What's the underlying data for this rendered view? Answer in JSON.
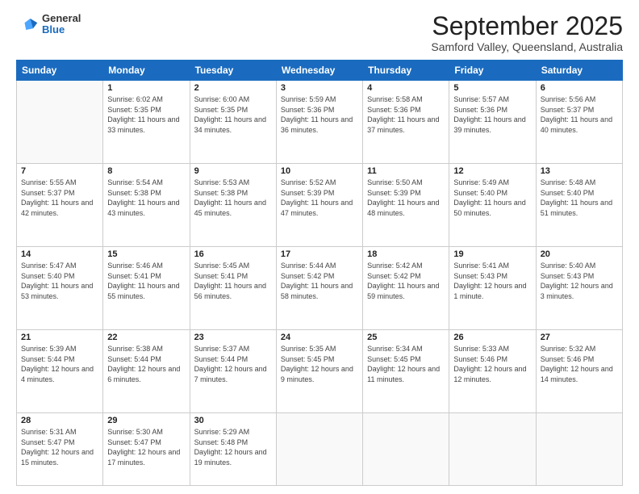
{
  "header": {
    "logo": {
      "line1": "General",
      "line2": "Blue"
    },
    "month": "September 2025",
    "location": "Samford Valley, Queensland, Australia"
  },
  "weekdays": [
    "Sunday",
    "Monday",
    "Tuesday",
    "Wednesday",
    "Thursday",
    "Friday",
    "Saturday"
  ],
  "days": [
    {
      "date": "",
      "sunrise": "",
      "sunset": "",
      "daylight": ""
    },
    {
      "date": "1",
      "sunrise": "6:02 AM",
      "sunset": "5:35 PM",
      "daylight": "11 hours and 33 minutes."
    },
    {
      "date": "2",
      "sunrise": "6:00 AM",
      "sunset": "5:35 PM",
      "daylight": "11 hours and 34 minutes."
    },
    {
      "date": "3",
      "sunrise": "5:59 AM",
      "sunset": "5:36 PM",
      "daylight": "11 hours and 36 minutes."
    },
    {
      "date": "4",
      "sunrise": "5:58 AM",
      "sunset": "5:36 PM",
      "daylight": "11 hours and 37 minutes."
    },
    {
      "date": "5",
      "sunrise": "5:57 AM",
      "sunset": "5:36 PM",
      "daylight": "11 hours and 39 minutes."
    },
    {
      "date": "6",
      "sunrise": "5:56 AM",
      "sunset": "5:37 PM",
      "daylight": "11 hours and 40 minutes."
    },
    {
      "date": "7",
      "sunrise": "5:55 AM",
      "sunset": "5:37 PM",
      "daylight": "11 hours and 42 minutes."
    },
    {
      "date": "8",
      "sunrise": "5:54 AM",
      "sunset": "5:38 PM",
      "daylight": "11 hours and 43 minutes."
    },
    {
      "date": "9",
      "sunrise": "5:53 AM",
      "sunset": "5:38 PM",
      "daylight": "11 hours and 45 minutes."
    },
    {
      "date": "10",
      "sunrise": "5:52 AM",
      "sunset": "5:39 PM",
      "daylight": "11 hours and 47 minutes."
    },
    {
      "date": "11",
      "sunrise": "5:50 AM",
      "sunset": "5:39 PM",
      "daylight": "11 hours and 48 minutes."
    },
    {
      "date": "12",
      "sunrise": "5:49 AM",
      "sunset": "5:40 PM",
      "daylight": "11 hours and 50 minutes."
    },
    {
      "date": "13",
      "sunrise": "5:48 AM",
      "sunset": "5:40 PM",
      "daylight": "11 hours and 51 minutes."
    },
    {
      "date": "14",
      "sunrise": "5:47 AM",
      "sunset": "5:40 PM",
      "daylight": "11 hours and 53 minutes."
    },
    {
      "date": "15",
      "sunrise": "5:46 AM",
      "sunset": "5:41 PM",
      "daylight": "11 hours and 55 minutes."
    },
    {
      "date": "16",
      "sunrise": "5:45 AM",
      "sunset": "5:41 PM",
      "daylight": "11 hours and 56 minutes."
    },
    {
      "date": "17",
      "sunrise": "5:44 AM",
      "sunset": "5:42 PM",
      "daylight": "11 hours and 58 minutes."
    },
    {
      "date": "18",
      "sunrise": "5:42 AM",
      "sunset": "5:42 PM",
      "daylight": "11 hours and 59 minutes."
    },
    {
      "date": "19",
      "sunrise": "5:41 AM",
      "sunset": "5:43 PM",
      "daylight": "12 hours and 1 minute."
    },
    {
      "date": "20",
      "sunrise": "5:40 AM",
      "sunset": "5:43 PM",
      "daylight": "12 hours and 3 minutes."
    },
    {
      "date": "21",
      "sunrise": "5:39 AM",
      "sunset": "5:44 PM",
      "daylight": "12 hours and 4 minutes."
    },
    {
      "date": "22",
      "sunrise": "5:38 AM",
      "sunset": "5:44 PM",
      "daylight": "12 hours and 6 minutes."
    },
    {
      "date": "23",
      "sunrise": "5:37 AM",
      "sunset": "5:44 PM",
      "daylight": "12 hours and 7 minutes."
    },
    {
      "date": "24",
      "sunrise": "5:35 AM",
      "sunset": "5:45 PM",
      "daylight": "12 hours and 9 minutes."
    },
    {
      "date": "25",
      "sunrise": "5:34 AM",
      "sunset": "5:45 PM",
      "daylight": "12 hours and 11 minutes."
    },
    {
      "date": "26",
      "sunrise": "5:33 AM",
      "sunset": "5:46 PM",
      "daylight": "12 hours and 12 minutes."
    },
    {
      "date": "27",
      "sunrise": "5:32 AM",
      "sunset": "5:46 PM",
      "daylight": "12 hours and 14 minutes."
    },
    {
      "date": "28",
      "sunrise": "5:31 AM",
      "sunset": "5:47 PM",
      "daylight": "12 hours and 15 minutes."
    },
    {
      "date": "29",
      "sunrise": "5:30 AM",
      "sunset": "5:47 PM",
      "daylight": "12 hours and 17 minutes."
    },
    {
      "date": "30",
      "sunrise": "5:29 AM",
      "sunset": "5:48 PM",
      "daylight": "12 hours and 19 minutes."
    }
  ],
  "labels": {
    "sunrise_prefix": "Sunrise: ",
    "sunset_prefix": "Sunset: ",
    "daylight_prefix": "Daylight: "
  }
}
